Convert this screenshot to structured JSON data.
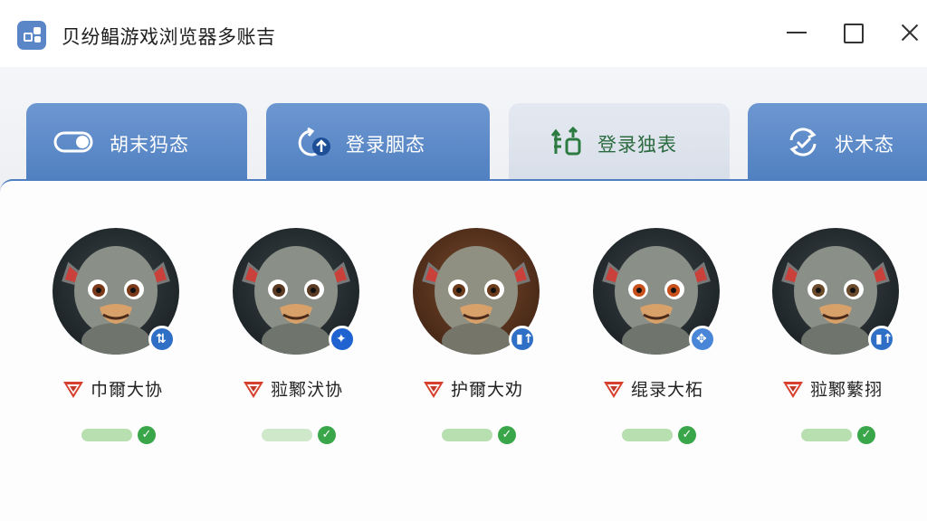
{
  "window": {
    "title": "贝纷鲳游戏浏览器多账吉"
  },
  "tabs": [
    {
      "label": "胡末犸态",
      "icon": "toggle-icon",
      "active": false
    },
    {
      "label": "登录胭态",
      "icon": "refresh-upload-icon",
      "active": false
    },
    {
      "label": "登录独表",
      "icon": "transfer-icon",
      "active": true
    },
    {
      "label": "状木态",
      "icon": "sync-icon",
      "active": false
    }
  ],
  "accounts": [
    {
      "name": "巾爾大协",
      "badge_icon": "transfer-badge-icon",
      "status": "online"
    },
    {
      "name": "翋鄹汱协",
      "badge_icon": "star-badge-icon",
      "status": "online"
    },
    {
      "name": "护爾大劝",
      "badge_icon": "stats-badge-icon",
      "status": "online"
    },
    {
      "name": "绲录大柘",
      "badge_icon": "move-badge-icon",
      "status": "online"
    },
    {
      "name": "翋鄹蘩挧",
      "badge_icon": "chart-badge-icon",
      "status": "online"
    }
  ],
  "colors": {
    "tab_blue": "#5a86c8",
    "tab_active": "#dfe5ee",
    "status_green": "#3aa64a"
  }
}
